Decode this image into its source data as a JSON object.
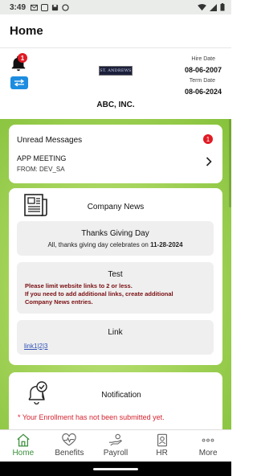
{
  "status_bar": {
    "time": "3:49"
  },
  "app_bar": {
    "title": "Home"
  },
  "header": {
    "notification_count": "1",
    "logo_text": "ST. ANDREWS",
    "company_name": "ABC, INC.",
    "hire_date_label": "Hire Date",
    "hire_date": "08-06-2007",
    "term_date_label": "Term Date",
    "term_date": "08-06-2024"
  },
  "unread": {
    "title": "Unread Messages",
    "count": "1",
    "subject": "APP MEETING",
    "from": "FROM: DEV_SA"
  },
  "news": {
    "title": "Company News",
    "items": [
      {
        "heading": "Thanks Giving Day",
        "body": "All, thanks giving day celebrates on ",
        "date": "11-28-2024"
      },
      {
        "heading": "Test",
        "line1": "Please limit website links to 2 or less.",
        "line2": "If you need to add additional links, create additional",
        "line3": "Company News entries."
      },
      {
        "heading": "Link",
        "link": "link1|2|3"
      }
    ]
  },
  "notification": {
    "title": "Notification",
    "warning": "* Your Enrollment has not been submitted yet."
  },
  "bottom_nav": [
    {
      "label": "Home",
      "icon": "home-icon",
      "active": true
    },
    {
      "label": "Benefits",
      "icon": "heart-pulse-icon"
    },
    {
      "label": "Payroll",
      "icon": "hand-money-icon"
    },
    {
      "label": "HR",
      "icon": "id-badge-icon"
    },
    {
      "label": "More",
      "icon": "more-dots-icon"
    }
  ],
  "colors": {
    "accent_green": "#3a8f3a",
    "badge_red": "#e01b24",
    "warning_red": "#d3232f",
    "link_blue": "#2c4fb5"
  }
}
